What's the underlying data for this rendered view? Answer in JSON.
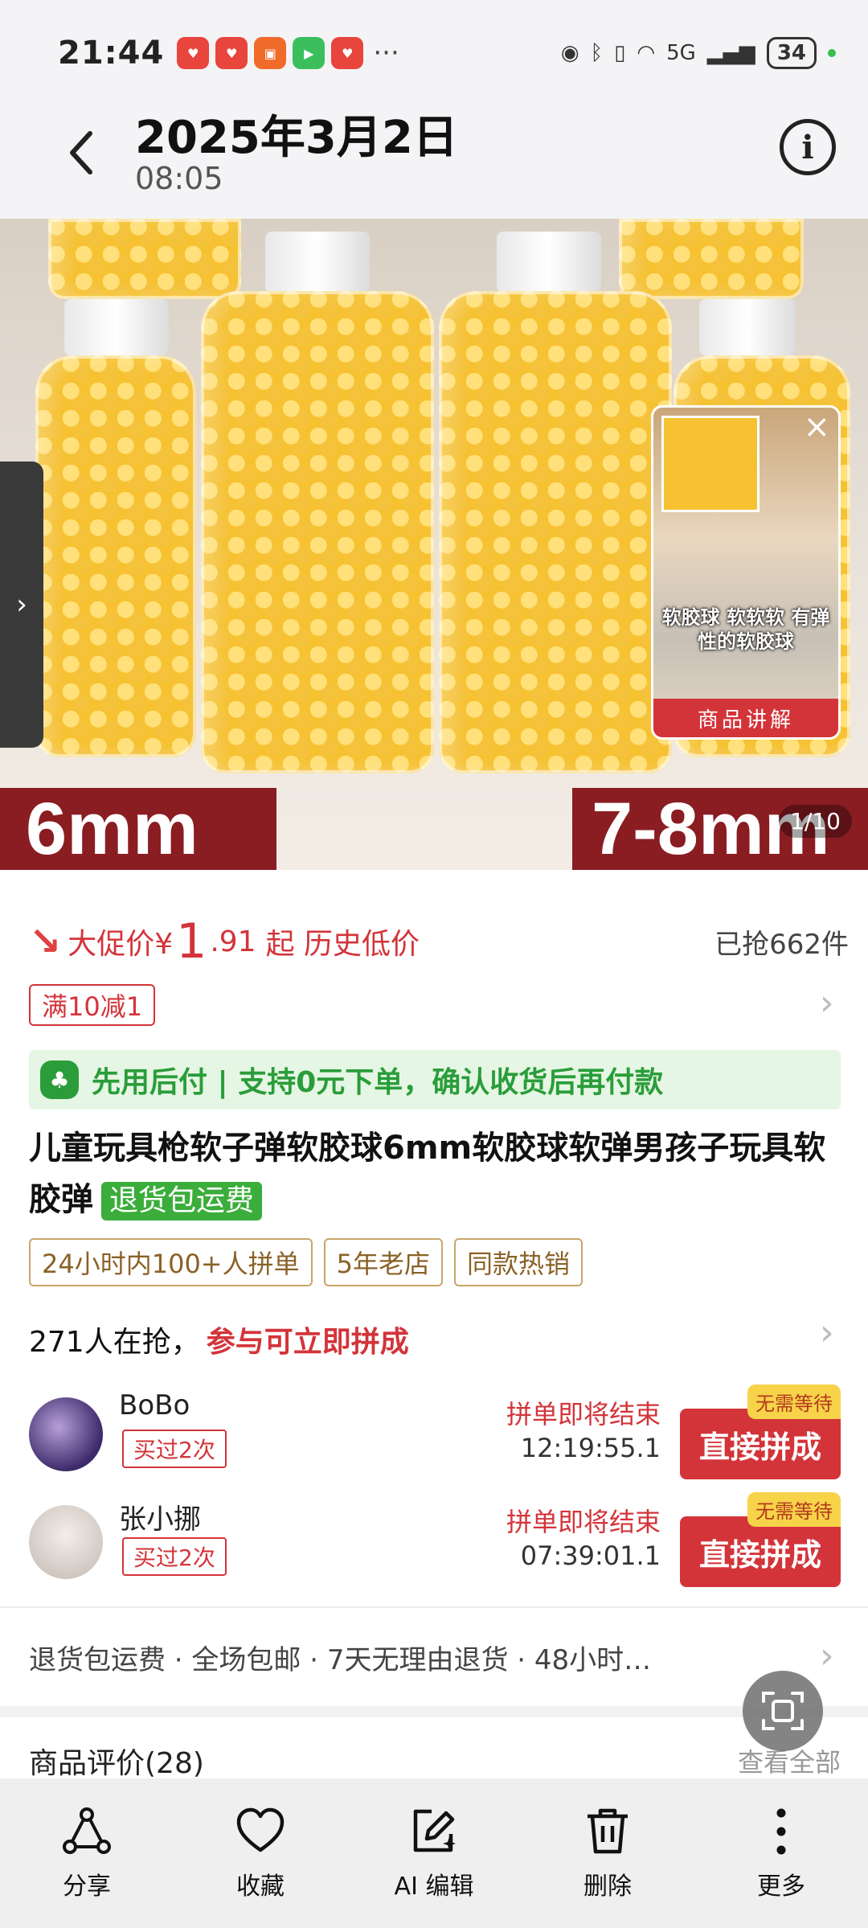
{
  "status_bar": {
    "time": "21:44",
    "battery": "34",
    "network": "5G"
  },
  "header": {
    "date": "2025年3月2日",
    "time": "08:05"
  },
  "hero": {
    "label_left": "6mm",
    "label_right": "7-8mm",
    "counter": "1/10",
    "video": {
      "caption": "软胶球 软软软 有弹性的软胶球",
      "button": "商品讲解"
    }
  },
  "product": {
    "promo_label": "大促价¥",
    "price_big": "1",
    "price_small": ".91",
    "price_suffix": "起 历史低价",
    "sold": "已抢662件",
    "coupon": "满10减1",
    "pay_later": "先用后付 | 支持0元下单，确认收货后再付款",
    "title": "儿童玩具枪软子弹软胶球6mm软胶球软弹男孩子玩具软胶弹",
    "title_tag": "退货包运费",
    "badges": [
      "24小时内100+人拼单",
      "5年老店",
      "同款热销"
    ]
  },
  "group": {
    "count_text": "271人在抢，",
    "hot_text": "参与可立即拼成",
    "items": [
      {
        "name": "BoBo",
        "bought": "买过2次",
        "ending": "拼单即将结束",
        "countdown": "12:19:55.1",
        "button": "直接拼成",
        "no_wait": "无需等待"
      },
      {
        "name": "张小挪",
        "bought": "买过2次",
        "ending": "拼单即将结束",
        "countdown": "07:39:01.1",
        "button": "直接拼成",
        "no_wait": "无需等待"
      }
    ]
  },
  "services": "退货包运费 · 全场包邮 · 7天无理由退货 · 48小时…",
  "reviews": {
    "label": "商品评价(28)",
    "view_all": "查看全部"
  },
  "toolbar": {
    "share": "分享",
    "favorite": "收藏",
    "ai_edit": "AI 编辑",
    "delete": "删除",
    "more": "更多"
  },
  "colors": {
    "brand_red": "#d3343a",
    "green": "#2a9d3a",
    "yellow": "#f6c232"
  }
}
